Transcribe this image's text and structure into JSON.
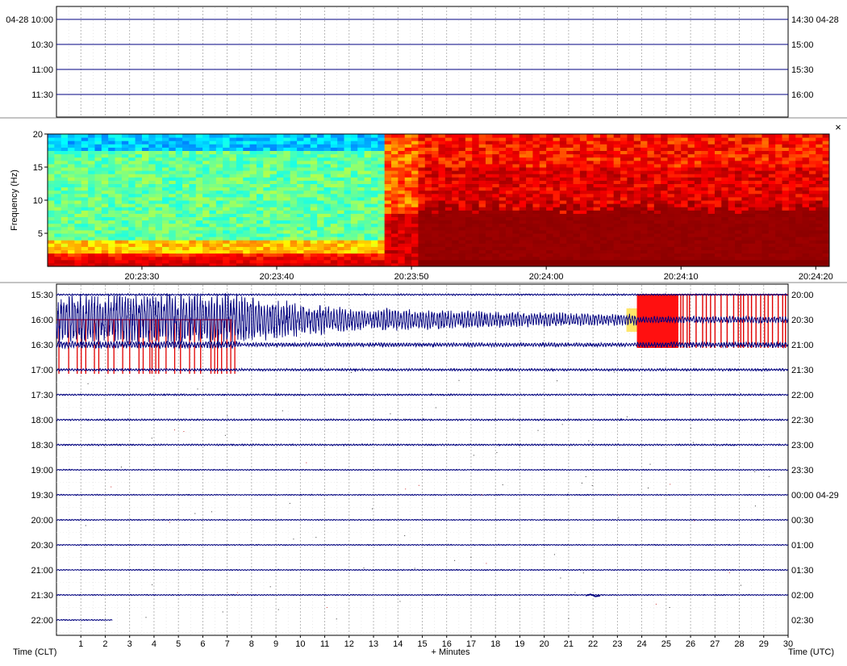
{
  "colors": {
    "trace": "#00007f",
    "trigger": "#e00000",
    "grid": "#a8a8a8",
    "hline": "#000080"
  },
  "icons": {
    "close": "close-icon"
  },
  "close_glyph": "×",
  "chart_data": [
    {
      "type": "line",
      "name_role": "helicorder-top",
      "left_labels": [
        "04-28 10:00",
        "10:30",
        "11:00",
        "11:30"
      ],
      "right_labels": [
        "14:30 04-28",
        "15:00",
        "15:30",
        "16:00"
      ]
    },
    {
      "type": "heatmap",
      "name_role": "spectrogram",
      "ylabel": "Frequency (Hz)",
      "ylim": [
        0,
        20
      ],
      "yticks": [
        5,
        10,
        15,
        20
      ],
      "xticks": [
        "20:23:30",
        "20:23:40",
        "20:23:50",
        "20:24:00",
        "20:24:10",
        "20:24:20"
      ],
      "time_range": [
        "20:23:23",
        "20:24:21"
      ],
      "onset_time": "20:23:49",
      "colormap": [
        "#00007f",
        "#0000ff",
        "#00ffff",
        "#ffff00",
        "#ff0000",
        "#800000"
      ],
      "levels": {
        "pre_event": 0.52,
        "post_event_low_freq": 0.98,
        "post_event_high_freq": 0.85
      }
    },
    {
      "type": "line",
      "name_role": "helicorder",
      "xlabel": "+ Minutes",
      "xlim": [
        0,
        30
      ],
      "xticks": [
        1,
        2,
        3,
        4,
        5,
        6,
        7,
        8,
        9,
        10,
        11,
        12,
        13,
        14,
        15,
        16,
        17,
        18,
        19,
        20,
        21,
        22,
        23,
        24,
        25,
        26,
        27,
        28,
        29,
        30
      ],
      "left_axis_title": "Time (CLT)",
      "right_axis_title": "Time (UTC)",
      "left_labels": [
        "15:30",
        "16:00",
        "16:30",
        "17:00",
        "17:30",
        "18:00",
        "18:30",
        "19:00",
        "19:30",
        "20:00",
        "20:30",
        "21:00",
        "21:30",
        "22:00"
      ],
      "right_labels": [
        "20:00",
        "20:30",
        "21:00",
        "21:30",
        "22:00",
        "22:30",
        "23:00",
        "23:30",
        "00:00 04-29",
        "00:30",
        "01:00",
        "01:30",
        "02:00",
        "02:30"
      ],
      "series": [
        {
          "line_label": "16:00",
          "max_amplitude": 1.0,
          "decay_minutes": [
            0,
            24
          ]
        },
        {
          "line_label": "16:30",
          "max_amplitude": 0.7,
          "clipped_from_minute": 23.8
        },
        {
          "line_label": "17:00",
          "max_amplitude": 0.15
        }
      ],
      "trigger_windows_minutes": [
        [
          0,
          7.5
        ],
        [
          23.8,
          30
        ]
      ],
      "last_line_end_minute": 2.3
    }
  ]
}
